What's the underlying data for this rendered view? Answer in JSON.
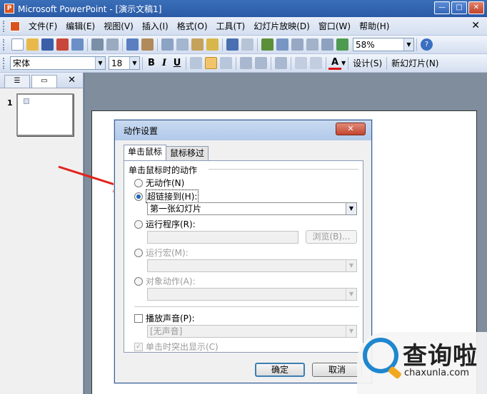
{
  "titlebar": {
    "app_icon": "P",
    "title": "Microsoft PowerPoint - [演示文稿1]",
    "min": "—",
    "max": "□",
    "close": "✕"
  },
  "menubar": {
    "items": [
      "文件(F)",
      "编辑(E)",
      "视图(V)",
      "插入(I)",
      "格式(O)",
      "工具(T)",
      "幻灯片放映(D)",
      "窗口(W)",
      "帮助(H)"
    ],
    "close_doc": "✕"
  },
  "standard_toolbar": {
    "zoom": "58%",
    "help": "?"
  },
  "format_toolbar": {
    "font": "宋体",
    "size": "18",
    "bold": "B",
    "italic": "I",
    "underline": "U",
    "font_color": "A",
    "design": "设计(S)",
    "new_slide": "新幻灯片(N)"
  },
  "left_panel": {
    "tab_outline": "☰",
    "tab_slides": "▭",
    "close": "✕",
    "slide_number": "1"
  },
  "dialog": {
    "title": "动作设置",
    "tabs": [
      "单击鼠标",
      "鼠标移过"
    ],
    "group_title": "单击鼠标时的动作",
    "none": "无动作(N)",
    "hyperlink": "超链接到(H):",
    "hyperlink_value": "第一张幻灯片",
    "run_program": "运行程序(R):",
    "run_program_value": "",
    "browse": "浏览(B)...",
    "run_macro": "运行宏(M):",
    "object_action": "对象动作(A):",
    "play_sound": "播放声音(P):",
    "sound_value": "[无声音]",
    "highlight": "单击时突出显示(C)",
    "ok": "确定",
    "cancel": "取消"
  },
  "watermark": {
    "name": "查询啦",
    "domain": "chaxunla.com"
  },
  "colors": {
    "title_bar": "#2a5aa6",
    "arrow": "#e2231a",
    "watermark_blue": "#1f87cf",
    "watermark_orange": "#f2a81d"
  }
}
